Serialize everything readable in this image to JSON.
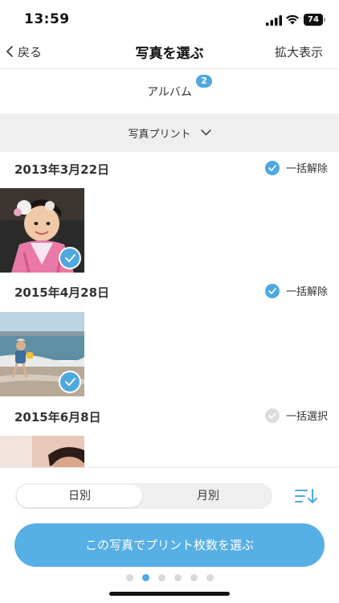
{
  "status": {
    "time": "13:59",
    "battery": "74"
  },
  "nav": {
    "back_label": "戻る",
    "title": "写真を選ぶ",
    "zoom_label": "拡大表示"
  },
  "album": {
    "label": "アルバム",
    "badge": "2"
  },
  "filter": {
    "label": "写真プリント"
  },
  "groups": [
    {
      "date": "2013年3月22日",
      "toggle_label": "一括解除",
      "selected": true
    },
    {
      "date": "2015年4月28日",
      "toggle_label": "一括解除",
      "selected": true
    },
    {
      "date": "2015年6月8日",
      "toggle_label": "一括選択",
      "selected": false
    }
  ],
  "view_toggle": {
    "options": [
      "日別",
      "月別"
    ],
    "selected": "日別"
  },
  "cta": {
    "label": "この写真でプリント枚数を選ぶ"
  },
  "pagination": {
    "total": 6,
    "current": 2
  },
  "colors": {
    "accent": "#4fa8e0",
    "cta": "#56afe5"
  },
  "icons": {
    "sort": "sort-descending-icon",
    "chevron": "chevron-down-icon",
    "check": "checkmark-icon"
  }
}
